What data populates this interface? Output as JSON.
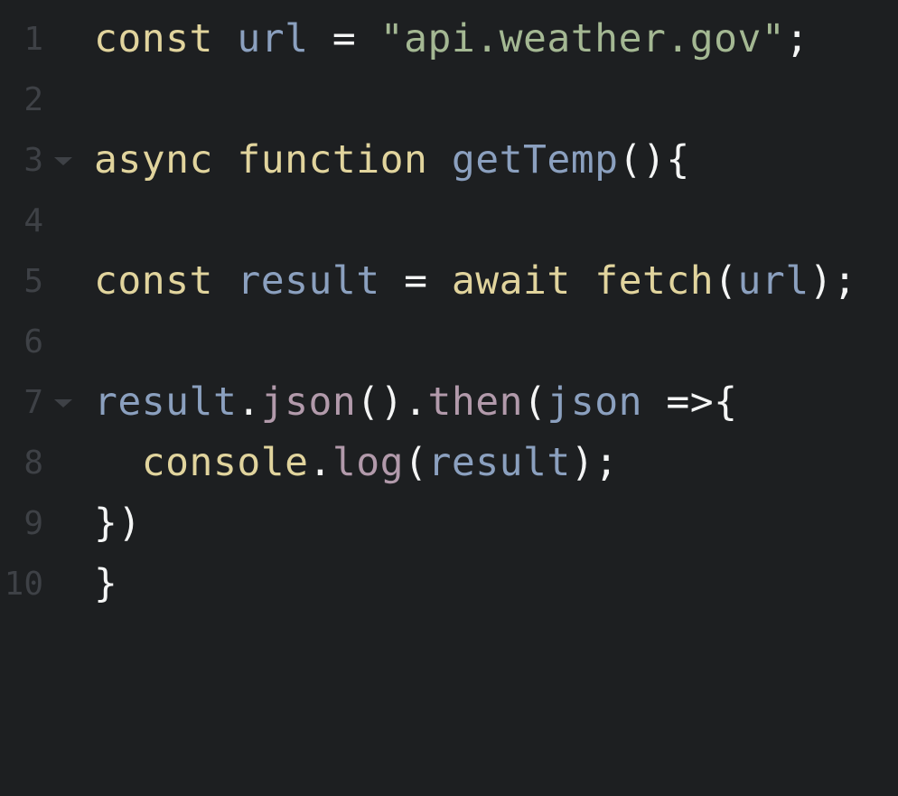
{
  "colors": {
    "background": "#1d1f21",
    "gutter": "#3e4146",
    "keyword": "#e1d49d",
    "variable": "#8ba0bf",
    "string": "#a4b893",
    "property": "#b29aab",
    "punctuation": "#f4f5f5"
  },
  "editor": {
    "lines": [
      {
        "number": "1",
        "tokens": [
          "const",
          " ",
          "url",
          " = ",
          "\"api.weather.gov\"",
          ";"
        ]
      },
      {
        "number": "2",
        "tokens": []
      },
      {
        "number": "3",
        "fold": "fold-arrow-icon",
        "tokens": [
          "async",
          " ",
          "function",
          " ",
          "getTemp",
          "(){"
        ]
      },
      {
        "number": "4",
        "tokens": []
      },
      {
        "number": "5",
        "tokens": [
          "const",
          " ",
          "result",
          " = ",
          "await",
          " ",
          "fetch",
          "(",
          "url",
          ");"
        ]
      },
      {
        "number": "6",
        "tokens": []
      },
      {
        "number": "7",
        "fold": "fold-arrow-icon",
        "tokens": [
          "result",
          ".",
          "json",
          "().",
          "then",
          "(",
          "json",
          " =>{"
        ]
      },
      {
        "number": "8",
        "tokens": [
          "  ",
          "console",
          ".",
          "log",
          "(",
          "result",
          ");"
        ]
      },
      {
        "number": "9",
        "tokens": [
          "})"
        ]
      },
      {
        "number": "10",
        "tokens": [
          "}"
        ]
      }
    ]
  }
}
